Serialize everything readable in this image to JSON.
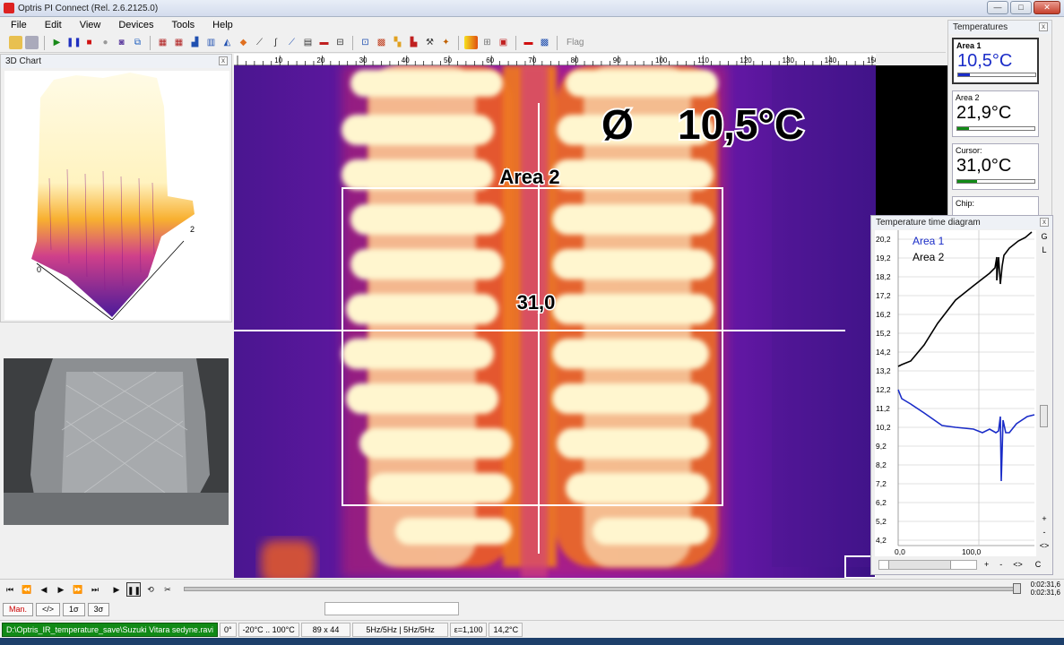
{
  "window": {
    "title": "Optris PI Connect (Rel. 2.6.2125.0)",
    "min": "—",
    "max": "□",
    "close": "✕"
  },
  "menu": [
    "File",
    "Edit",
    "View",
    "Devices",
    "Tools",
    "Help"
  ],
  "toolbar": {
    "flag_label": "Flag"
  },
  "chart3d": {
    "title": "3D Chart",
    "axis_label_a": "0",
    "axis_label_b": "2"
  },
  "ruler": {
    "ticks": [
      "10",
      "20",
      "30",
      "40",
      "50",
      "60",
      "70",
      "80",
      "90",
      "100",
      "110",
      "120",
      "130",
      "140",
      "150"
    ]
  },
  "thermal": {
    "area_label": "Area 2",
    "avg_symbol": "Ø",
    "avg_value": "10,5°C",
    "cursor_value": "31,0"
  },
  "temperatures": {
    "title": "Temperatures",
    "items": [
      {
        "label": "Area 1",
        "value": "10,5°C",
        "color": "#1a2cc8",
        "fill": 0.15
      },
      {
        "label": "Area 2",
        "value": "21,9°C",
        "color": "#000000",
        "fill": 0.15
      },
      {
        "label": "Cursor:",
        "value": "31,0°C",
        "color": "#000000",
        "fill": 0.25
      },
      {
        "label": "Chip:",
        "value": "",
        "color": "#cc0000",
        "fill": 0
      }
    ]
  },
  "timediag": {
    "title": "Temperature time diagram",
    "legend": [
      "Area 1",
      "Area 2"
    ],
    "y_ticks": [
      "20,2",
      "19,2",
      "18,2",
      "17,2",
      "16,2",
      "15,2",
      "14,2",
      "13,2",
      "12,2",
      "11,2",
      "10,2",
      "9,2",
      "8,2",
      "7,2",
      "6,2",
      "5,2",
      "4,2"
    ],
    "x_ticks": [
      "0,0",
      "100,0"
    ],
    "side": [
      "G",
      "L",
      "+",
      "-",
      "<>"
    ],
    "bottom": [
      "+",
      "-",
      "<>",
      "C"
    ]
  },
  "playback": {
    "time_a": "0:02:31,6",
    "time_b": "0:02:31,6"
  },
  "controls": [
    "Man.",
    "</>",
    "1σ",
    "3σ"
  ],
  "status": {
    "path": "D:\\Optris_IR_temperature_save\\Suzuki Vitara sedyne.ravi",
    "angle": "0°",
    "range": "-20°C .. 100°C",
    "resolution": "89 x 44",
    "rate": "5Hz/5Hz | 5Hz/5Hz",
    "emissivity": "ε=1,100",
    "temp": "14,2°C"
  }
}
